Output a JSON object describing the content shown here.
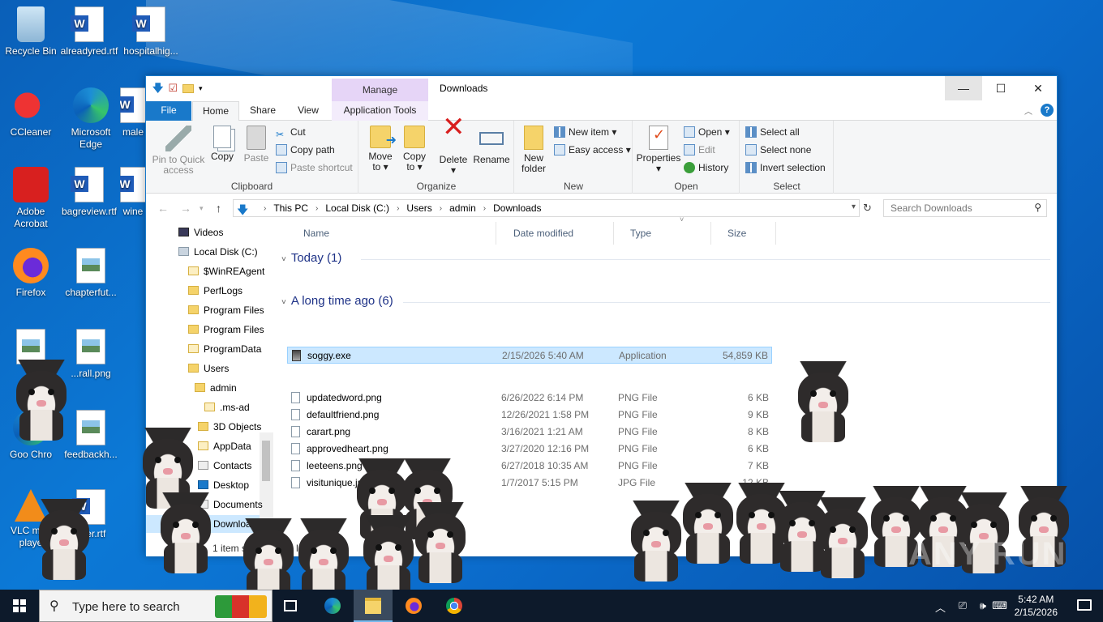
{
  "desktop": {
    "icons": [
      {
        "label": "Recycle Bin",
        "icon": "recycle-bin-icon"
      },
      {
        "label": "alreadyred.rtf",
        "icon": "word-document-icon"
      },
      {
        "label": "hospitalhig...",
        "icon": "word-document-icon"
      },
      {
        "label": "CCleaner",
        "icon": "ccleaner-icon"
      },
      {
        "label": "Microsoft Edge",
        "icon": "edge-icon"
      },
      {
        "label": "male",
        "icon": "word-document-icon"
      },
      {
        "label": "Adobe Acrobat",
        "icon": "acrobat-icon"
      },
      {
        "label": "bagreview.rtf",
        "icon": "word-document-icon"
      },
      {
        "label": "wine",
        "icon": "word-document-icon"
      },
      {
        "label": "Firefox",
        "icon": "firefox-icon"
      },
      {
        "label": "chapterfut...",
        "icon": "image-file-icon"
      },
      {
        "label": "c",
        "icon": "image-file-icon"
      },
      {
        "label": "...rall.png",
        "icon": "image-file-icon"
      },
      {
        "label": "Goo Chro",
        "icon": "chrome-icon"
      },
      {
        "label": "feedbackh...",
        "icon": "image-file-icon"
      },
      {
        "label": "VLC med playe",
        "icon": "vlc-icon"
      },
      {
        "label": "user.rtf",
        "icon": "word-document-icon"
      }
    ]
  },
  "window": {
    "title": "Downloads",
    "manage_tab": "Manage",
    "tabs": {
      "file": "File",
      "home": "Home",
      "share": "Share",
      "view": "View",
      "app_tools": "Application Tools"
    },
    "controls": {
      "minimize": "—",
      "maximize": "☐",
      "close": "✕"
    }
  },
  "ribbon": {
    "clipboard": {
      "label": "Clipboard",
      "pin": "Pin to Quick access",
      "copy": "Copy",
      "paste": "Paste",
      "cut": "Cut",
      "copy_path": "Copy path",
      "paste_shortcut": "Paste shortcut"
    },
    "organize": {
      "label": "Organize",
      "move_to": "Move to ▾",
      "copy_to": "Copy to ▾",
      "delete": "Delete ▾",
      "rename": "Rename"
    },
    "new": {
      "label": "New",
      "new_folder": "New folder",
      "new_item": "New item ▾",
      "easy_access": "Easy access ▾"
    },
    "open": {
      "label": "Open",
      "properties": "Properties ▾",
      "open": "Open ▾",
      "edit": "Edit",
      "history": "History"
    },
    "select": {
      "label": "Select",
      "select_all": "Select all",
      "select_none": "Select none",
      "invert": "Invert selection"
    }
  },
  "address": {
    "crumbs": [
      "This PC",
      "Local Disk (C:)",
      "Users",
      "admin",
      "Downloads"
    ],
    "search_placeholder": "Search Downloads"
  },
  "nav": {
    "items": [
      {
        "label": "Videos",
        "kind": "video"
      },
      {
        "label": "Local Disk (C:)",
        "kind": "drive"
      },
      {
        "label": "$WinREAgent",
        "kind": "light"
      },
      {
        "label": "PerfLogs",
        "kind": "folder"
      },
      {
        "label": "Program Files",
        "kind": "folder"
      },
      {
        "label": "Program Files",
        "kind": "folder"
      },
      {
        "label": "ProgramData",
        "kind": "light"
      },
      {
        "label": "Users",
        "kind": "folder"
      },
      {
        "label": "admin",
        "kind": "folder"
      },
      {
        "label": ".ms-ad",
        "kind": "light"
      },
      {
        "label": "3D Objects",
        "kind": "folder"
      },
      {
        "label": "AppData",
        "kind": "light"
      },
      {
        "label": "Contacts",
        "kind": "doc"
      },
      {
        "label": "Desktop",
        "kind": "desk"
      },
      {
        "label": "Documents",
        "kind": "doc"
      },
      {
        "label": "Downloads",
        "kind": "dl"
      }
    ]
  },
  "columns": {
    "name": "Name",
    "date": "Date modified",
    "type": "Type",
    "size": "Size"
  },
  "groups": {
    "today": "Today (1)",
    "long_ago": "A long time ago (6)"
  },
  "files_today": [
    {
      "name": "soggy.exe",
      "date": "2/15/2026 5:40 AM",
      "type": "Application",
      "size": "54,859 KB"
    }
  ],
  "files_old": [
    {
      "name": "updatedword.png",
      "date": "6/26/2022 6:14 PM",
      "type": "PNG File",
      "size": "6 KB"
    },
    {
      "name": "defaultfriend.png",
      "date": "12/26/2021 1:58 PM",
      "type": "PNG File",
      "size": "9 KB"
    },
    {
      "name": "carart.png",
      "date": "3/16/2021 1:21 AM",
      "type": "PNG File",
      "size": "8 KB"
    },
    {
      "name": "approvedheart.png",
      "date": "3/27/2020 12:16 PM",
      "type": "PNG File",
      "size": "6 KB"
    },
    {
      "name": "leeteens.png",
      "date": "6/27/2018 10:35 AM",
      "type": "PNG File",
      "size": "7 KB"
    },
    {
      "name": "visitunique.jpg",
      "date": "1/7/2017 5:15 PM",
      "type": "JPG File",
      "size": "12 KB"
    }
  ],
  "status": {
    "items": "1 item se",
    "size": "53.5 I"
  },
  "watermark": "ANY RUN",
  "taskbar": {
    "search_placeholder": "Type here to search",
    "time": "5:42 AM",
    "date": "2/15/2026"
  }
}
